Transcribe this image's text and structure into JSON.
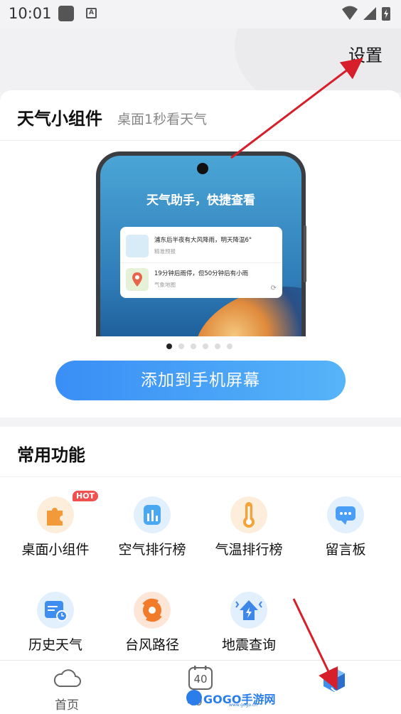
{
  "status_bar": {
    "time": "10:01",
    "a_icon": "A"
  },
  "header": {
    "settings_label": "设置"
  },
  "widget_card": {
    "title": "天气小组件",
    "subtitle": "桌面1秒看天气",
    "preview": {
      "headline": "天气助手，快捷查看",
      "rows": [
        {
          "main": "浦东后半夜有大风降雨，明天降温6°",
          "sub": "精准预报",
          "icon": "weather-icon"
        },
        {
          "main": "19分钟后雨停，但50分钟后有小雨",
          "sub": "气象地图",
          "icon": "map-pin-icon"
        }
      ]
    },
    "pagination": {
      "count": 6,
      "active": 0
    },
    "add_button_label": "添加到手机屏幕"
  },
  "common_features": {
    "title": "常用功能",
    "items": [
      {
        "label": "桌面小组件",
        "icon": "puzzle-icon",
        "badge": "HOT",
        "color": "#f7a35c"
      },
      {
        "label": "空气排行榜",
        "icon": "bar-chart-icon",
        "color": "#4aa8f0"
      },
      {
        "label": "气温排行榜",
        "icon": "thermometer-icon",
        "color": "#f5a23b"
      },
      {
        "label": "留言板",
        "icon": "message-icon",
        "color": "#4b9ef5"
      },
      {
        "label": "历史天气",
        "icon": "calendar-clock-icon",
        "color": "#3d8ef0"
      },
      {
        "label": "台风路径",
        "icon": "typhoon-icon",
        "color": "#f27b2a"
      },
      {
        "label": "地震查询",
        "icon": "earthquake-icon",
        "color": "#3e86e8"
      }
    ]
  },
  "bottom_nav": {
    "items": [
      {
        "label": "首页",
        "icon": "cloud-icon"
      },
      {
        "label": "40",
        "icon": "calendar-40-icon",
        "number": "40"
      },
      {
        "label": "",
        "icon": "profile-cube-icon"
      }
    ]
  },
  "watermark": {
    "text": "GOGO手游网",
    "url": "www.gogo.cn"
  },
  "colors": {
    "accent": "#3a8ef6",
    "annotation_arrow": "#d61f2a"
  }
}
